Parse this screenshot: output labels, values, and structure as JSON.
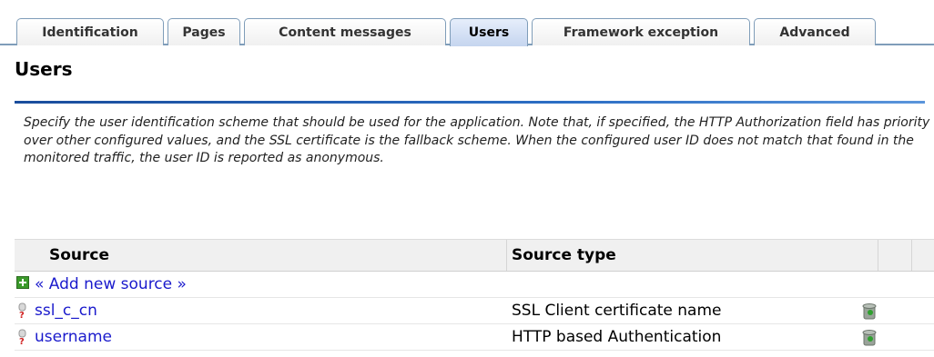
{
  "tabs": [
    {
      "label": "Identification",
      "active": false
    },
    {
      "label": "Pages",
      "active": false
    },
    {
      "label": "Content messages",
      "active": false
    },
    {
      "label": "Users",
      "active": true
    },
    {
      "label": "Framework exception",
      "active": false
    },
    {
      "label": "Advanced",
      "active": false
    }
  ],
  "page": {
    "title": "Users",
    "description": "Specify the user identification scheme that should be used for the application. Note that, if specified, the HTTP Authorization field has priority over other configured values, and the SSL certificate is the fallback scheme. When the configured user ID does not match that found in the monitored traffic, the user ID is reported as anonymous."
  },
  "table": {
    "headers": {
      "source": "Source",
      "source_type": "Source type"
    },
    "add_label": "« Add new source »",
    "rows": [
      {
        "source": "ssl_c_cn",
        "source_type": "SSL Client certificate name"
      },
      {
        "source": "username",
        "source_type": "HTTP based Authentication"
      }
    ]
  },
  "colors": {
    "accent": "#1a4d9c",
    "link": "#1a1acc",
    "tab_border": "#7f9db9"
  }
}
